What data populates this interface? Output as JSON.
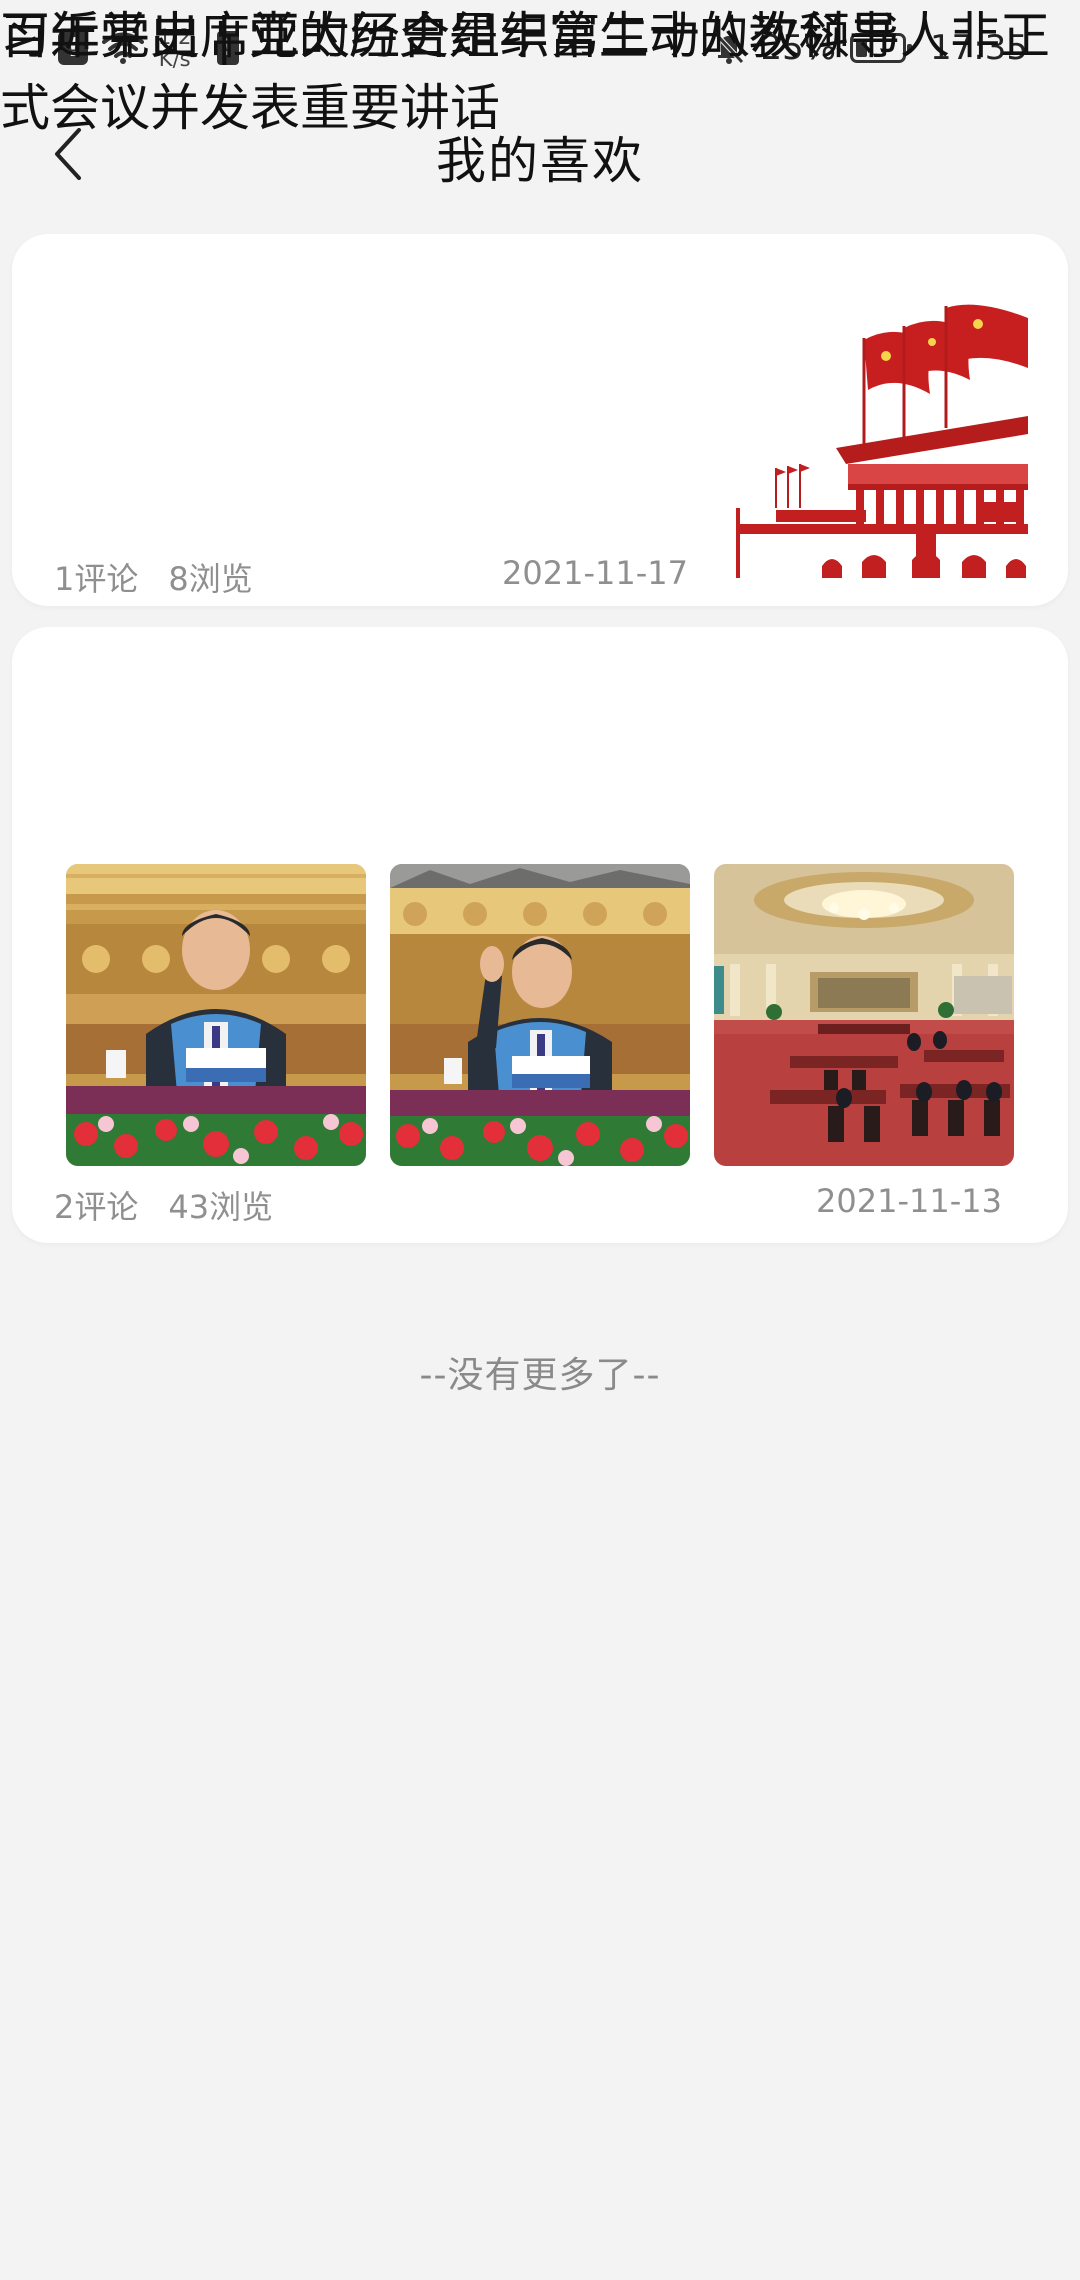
{
  "status_bar": {
    "alert_1": "!",
    "speed_value": "1.2",
    "speed_unit": "K/s",
    "alert_2": "!",
    "battery_percent": "25%",
    "battery_level": 0.25,
    "time": "17:35"
  },
  "header": {
    "title": "我的喜欢"
  },
  "items": [
    {
      "title": "百年党史 | 党的历史是丰富生动的教科书",
      "comments": "1评论",
      "views": "8浏览",
      "date": "2021-11-17"
    },
    {
      "title": "习近平出席亚太经合组织第二十八次领导人非正式会议并发表重要讲话",
      "comments": "2评论",
      "views": "43浏览",
      "date": "2021-11-13"
    }
  ],
  "footer": {
    "no_more": "--没有更多了--"
  }
}
